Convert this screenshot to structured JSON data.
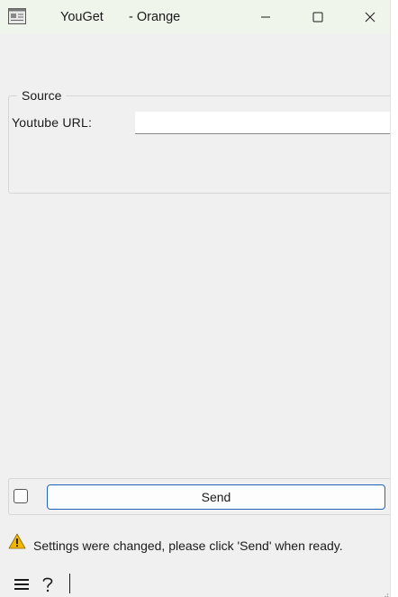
{
  "window": {
    "app_name": "YouGet",
    "app_suffix": "- Orange",
    "icons": {
      "app": "document-list-icon",
      "minimize": "minimize-icon",
      "maximize": "maximize-icon",
      "close": "close-icon"
    }
  },
  "source_group": {
    "title": "Source",
    "url_label": "Youtube URL:",
    "url_value": ""
  },
  "controls": {
    "auto_send_checked": false,
    "send_label": "Send"
  },
  "status": {
    "icon": "warning-icon",
    "warning_color": "#f2b600",
    "message": "Settings were changed, please click 'Send' when ready."
  },
  "footer": {
    "menu_icon": "hamburger-menu-icon",
    "help_icon": "help-icon"
  },
  "colors": {
    "titlebar": "#eff5ea",
    "window_bg": "#f0f0f0",
    "accent_border": "#2563b8"
  }
}
